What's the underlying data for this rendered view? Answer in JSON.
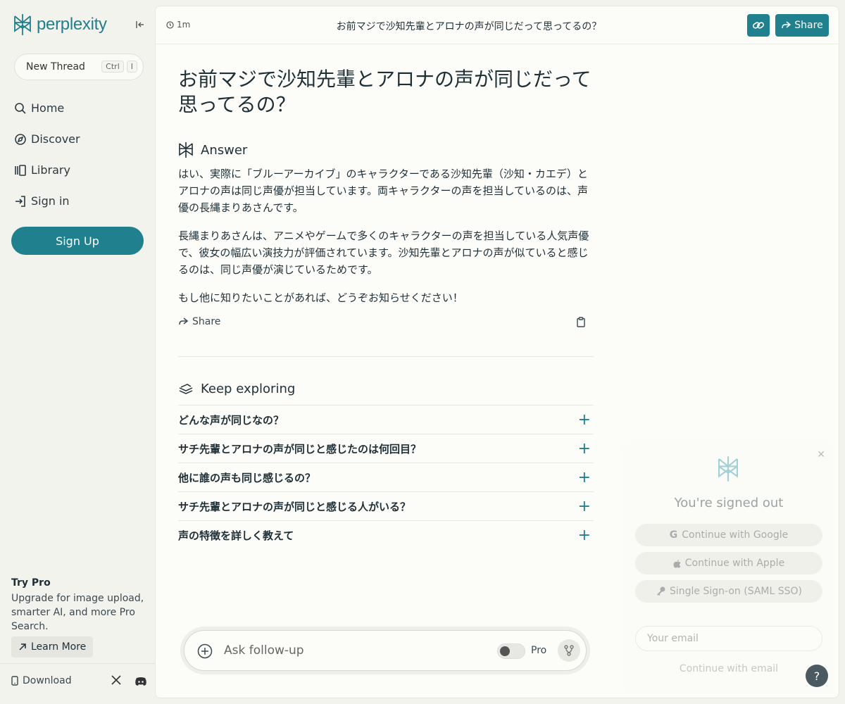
{
  "brand": {
    "name": "perplexity"
  },
  "sidebar": {
    "new_thread": "New Thread",
    "kbd_ctrl": "Ctrl",
    "kbd_i": "I",
    "nav": [
      {
        "label": "Home",
        "icon": "search-icon"
      },
      {
        "label": "Discover",
        "icon": "compass-icon"
      },
      {
        "label": "Library",
        "icon": "library-icon"
      },
      {
        "label": "Sign in",
        "icon": "sign-in-icon"
      }
    ],
    "signup": "Sign Up",
    "try_pro_title": "Try Pro",
    "try_pro_desc": "Upgrade for image upload, smarter AI, and more Pro Search.",
    "learn_more": "Learn More",
    "download": "Download"
  },
  "topbar": {
    "time": "1m",
    "title": "お前マジで沙知先輩とアロナの声が同じだって思ってるの？",
    "share": "Share"
  },
  "thread": {
    "question": "お前マジで沙知先輩とアロナの声が同じだって思ってるの？",
    "answer_heading": "Answer",
    "answer_paragraphs": [
      "はい、実際に「ブルーアーカイブ」のキャラクターである沙知先輩（沙知・カエデ）とアロナの声は同じ声優が担当しています。両キャラクターの声を担当しているのは、声優の長縄まりあさんです。",
      "長縄まりあさんは、アニメやゲームで多くのキャラクターの声を担当している人気声優で、彼女の幅広い演技力が評価されています。沙知先輩とアロナの声が似ていると感じるのは、同じ声優が演じているためです。",
      "もし他に知りたいことがあれば、どうぞお知らせください！"
    ],
    "share": "Share",
    "keep_exploring": "Keep exploring",
    "related": [
      "どんな声が同じなの？",
      "サチ先輩とアロナの声が同じと感じたのは何回目？",
      "他に誰の声も同じ感じるの？",
      "サチ先輩とアロナの声が同じと感じる人がいる？",
      "声の特徴を詳しく教えて"
    ]
  },
  "followup": {
    "placeholder": "Ask follow-up",
    "pro_label": "Pro"
  },
  "signed_out": {
    "title": "You're signed out",
    "google": "Continue with Google",
    "apple": "Continue with Apple",
    "sso": "Single Sign-on (SAML SSO)",
    "email_placeholder": "Your email",
    "continue_email": "Continue with email"
  },
  "help": "?",
  "colors": {
    "accent": "#20808d",
    "bg": "#f3f3ee",
    "surface": "#fcfcf9"
  }
}
